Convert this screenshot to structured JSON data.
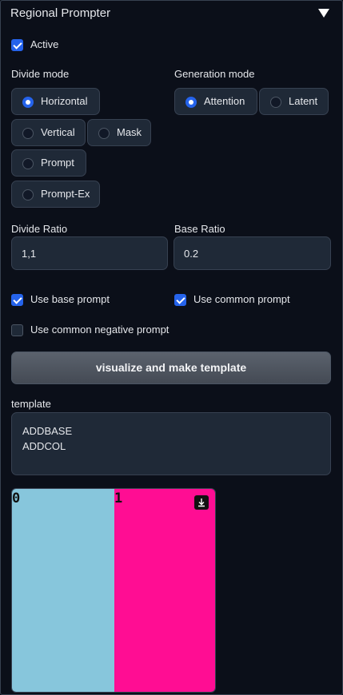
{
  "panel": {
    "title": "Regional Prompter"
  },
  "active": {
    "label": "Active",
    "checked": true
  },
  "divide_mode": {
    "label": "Divide mode",
    "options": [
      "Horizontal",
      "Vertical",
      "Mask",
      "Prompt",
      "Prompt-Ex"
    ],
    "selected": "Horizontal"
  },
  "generation_mode": {
    "label": "Generation mode",
    "options": [
      "Attention",
      "Latent"
    ],
    "selected": "Attention"
  },
  "divide_ratio": {
    "label": "Divide Ratio",
    "value": "1,1"
  },
  "base_ratio": {
    "label": "Base Ratio",
    "value": "0.2"
  },
  "use_base_prompt": {
    "label": "Use base prompt",
    "checked": true
  },
  "use_common_prompt": {
    "label": "Use common prompt",
    "checked": true
  },
  "use_common_negative_prompt": {
    "label": "Use common negative prompt",
    "checked": false
  },
  "visualize_button": {
    "label": "visualize and make template"
  },
  "template": {
    "label": "template",
    "line1": "ADDBASE",
    "line2": "ADDCOL"
  },
  "preview": {
    "regions": [
      {
        "label": "0",
        "color": "#87c6dc"
      },
      {
        "label": "1",
        "color": "#ff0d93"
      }
    ],
    "download_icon": "download-icon"
  },
  "colors": {
    "accent": "#2563eb",
    "background": "#0b0f19"
  }
}
